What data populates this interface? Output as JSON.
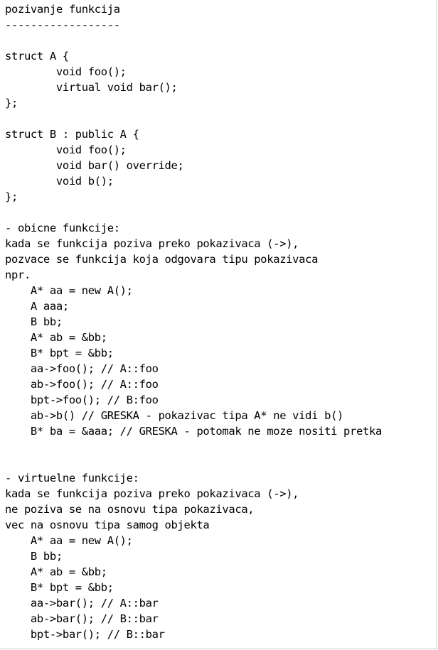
{
  "document": {
    "lines": [
      "pozivanje funkcija",
      "------------------",
      "",
      "struct A {",
      "        void foo();",
      "        virtual void bar();",
      "};",
      "",
      "struct B : public A {",
      "        void foo();",
      "        void bar() override;",
      "        void b();",
      "};",
      "",
      "- obicne funkcije:",
      "kada se funkcija poziva preko pokazivaca (->),",
      "pozvace se funkcija koja odgovara tipu pokazivaca",
      "npr.",
      "    A* aa = new A();",
      "    A aaa;",
      "    B bb;",
      "    A* ab = &bb;",
      "    B* bpt = &bb;",
      "    aa->foo(); // A::foo",
      "    ab->foo(); // A::foo",
      "    bpt->foo(); // B:foo",
      "    ab->b() // GRESKA - pokazivac tipa A* ne vidi b()",
      "    B* ba = &aaa; // GRESKA - potomak ne moze nositi pretka",
      "",
      "",
      "- virtuelne funkcije:",
      "kada se funkcija poziva preko pokazivaca (->),",
      "ne poziva se na osnovu tipa pokazivaca,",
      "vec na osnovu tipa samog objekta",
      "    A* aa = new A();",
      "    B bb;",
      "    A* ab = &bb;",
      "    B* bpt = &bb;",
      "    aa->bar(); // A::bar",
      "    ab->bar(); // B::bar",
      "    bpt->bar(); // B::bar"
    ]
  }
}
